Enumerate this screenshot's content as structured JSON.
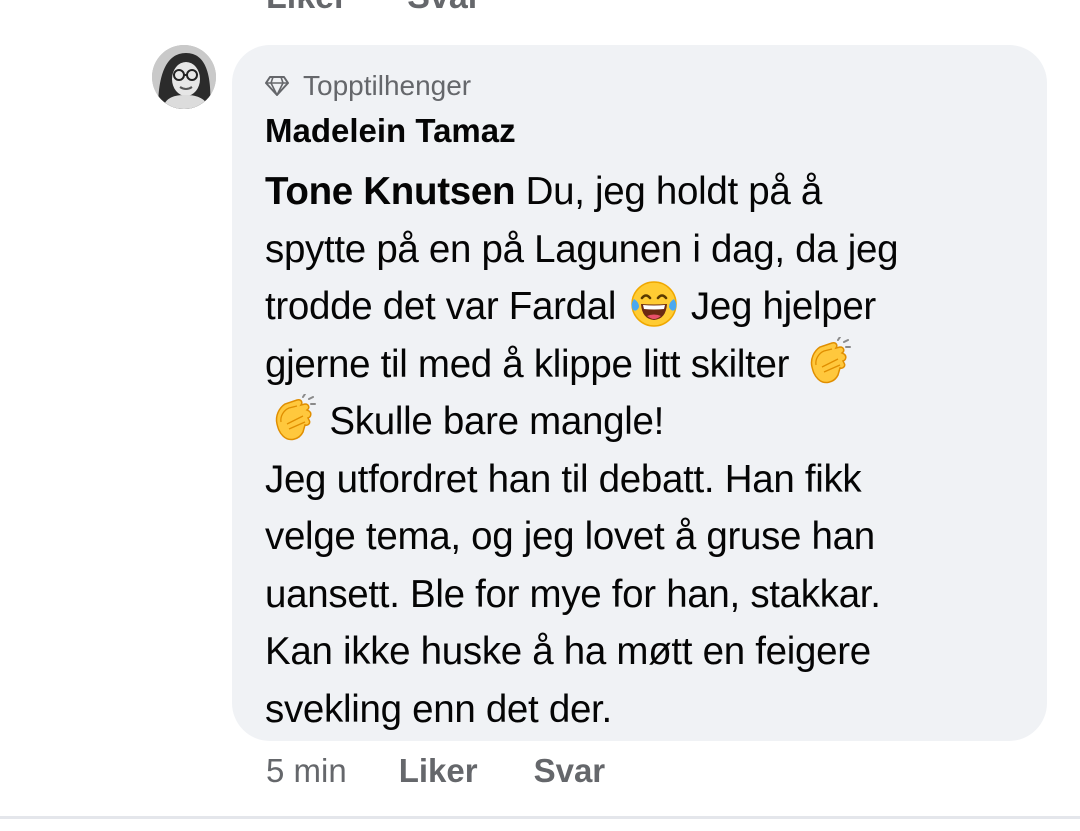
{
  "previous_comment": {
    "actions": [
      "Liker",
      "Svar"
    ]
  },
  "comment": {
    "badge": "Topptilhenger",
    "author": "Madelein Tamaz",
    "mention": "Tone Knutsen",
    "lines": {
      "l1": "Du, jeg holdt på å",
      "l2": "spytte på en på Lagunen i dag, da jeg",
      "l3a": "trodde det var Fardal",
      "l3b": "Jeg hjelper",
      "l4": "gjerne til med å klippe litt skilter",
      "l5": "Skulle bare mangle!",
      "l6": "Jeg utfordret han til debatt. Han fikk",
      "l7": "velge tema, og jeg lovet å gruse han",
      "l8": "uansett. Ble for mye for han, stakkar.",
      "l9": "Kan ikke huske å ha møtt en feigere",
      "l10": "svekling enn det der."
    },
    "emojis": [
      "laughing-tears-emoji",
      "clapping-hands-emoji",
      "clapping-hands-emoji"
    ],
    "time": "5 min",
    "like_label": "Liker",
    "reply_label": "Svar"
  },
  "colors": {
    "bubble_bg": "#f0f2f5",
    "text": "#050505",
    "secondary_text": "#65676b"
  }
}
